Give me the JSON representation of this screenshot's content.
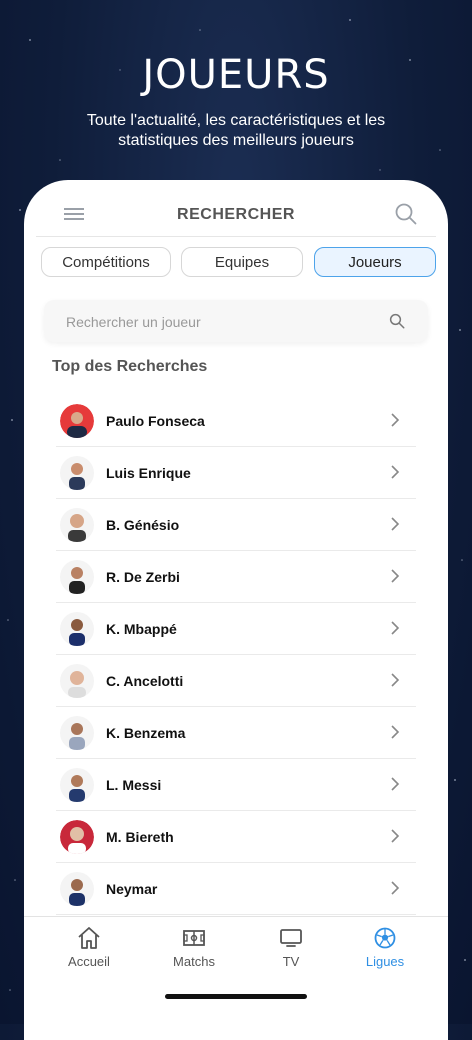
{
  "hero": {
    "title": "JOUEURS",
    "subtitle": "Toute l'actualité, les caractéristiques et les statistiques des meilleurs joueurs"
  },
  "header": {
    "title": "RECHERCHER"
  },
  "tabs": [
    {
      "label": "Compétitions",
      "active": false
    },
    {
      "label": "Equipes",
      "active": false
    },
    {
      "label": "Joueurs",
      "active": true
    }
  ],
  "search": {
    "placeholder": "Rechercher un joueur",
    "value": ""
  },
  "section_title": "Top des Recherches",
  "players": [
    {
      "name": "Paulo Fonseca"
    },
    {
      "name": "Luis Enrique"
    },
    {
      "name": "B. Génésio"
    },
    {
      "name": "R. De Zerbi"
    },
    {
      "name": "K. Mbappé"
    },
    {
      "name": "C. Ancelotti"
    },
    {
      "name": "K. Benzema"
    },
    {
      "name": "L. Messi"
    },
    {
      "name": "M. Biereth"
    },
    {
      "name": "Neymar"
    }
  ],
  "bottom_nav": [
    {
      "label": "Accueil",
      "icon": "home-icon",
      "active": false
    },
    {
      "label": "Matchs",
      "icon": "pitch-icon",
      "active": false
    },
    {
      "label": "TV",
      "icon": "tv-icon",
      "active": false
    },
    {
      "label": "Ligues",
      "icon": "soccer-ball-icon",
      "active": true
    }
  ],
  "colors": {
    "accent": "#2f8fe3",
    "background": "#0f1d3a",
    "active_tab_bg": "#eaf4ff"
  }
}
